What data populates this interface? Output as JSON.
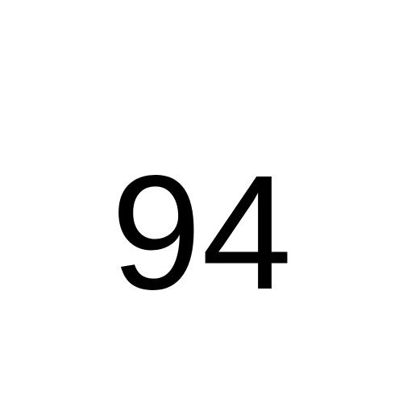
{
  "display": {
    "value": "94",
    "text_color": "#000000",
    "background_color": "#ffffff"
  }
}
